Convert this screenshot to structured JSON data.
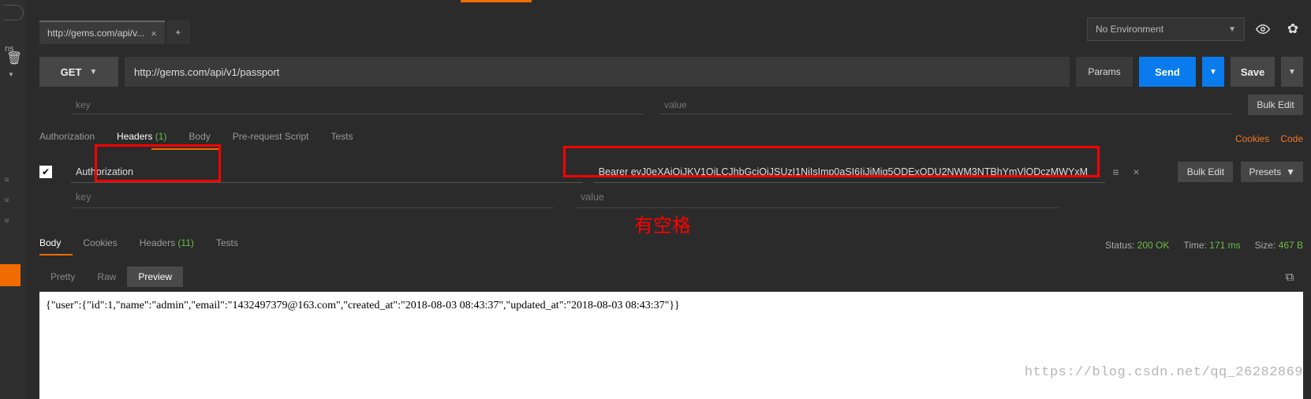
{
  "sidebar": {
    "ns_label": "ns"
  },
  "top": {
    "tab_title": "http://gems.com/api/v...",
    "env_label": "No Environment"
  },
  "request": {
    "method": "GET",
    "url": "http://gems.com/api/v1/passport",
    "params_btn": "Params",
    "send_btn": "Send",
    "save_btn": "Save",
    "key_ph": "key",
    "value_ph": "value",
    "bulk_edit": "Bulk Edit"
  },
  "editor_tabs": {
    "auth": "Authorization",
    "headers_label": "Headers",
    "headers_count": "(1)",
    "body": "Body",
    "prereq": "Pre-request Script",
    "tests": "Tests",
    "cookies": "Cookies",
    "code": "Code"
  },
  "header_row": {
    "key": "Authorization",
    "value": "Bearer eyJ0eXAiOiJKV1QiLCJhbGciOiJSUzI1NiIsImp0aSI6IjJiMjg5ODExODU2NWM3NTBhYmVlODczMWYxM",
    "bulk_edit": "Bulk Edit",
    "presets": "Presets"
  },
  "placeholders": {
    "key": "key",
    "value": "value"
  },
  "annotation": "有空格",
  "resp_tabs": {
    "body": "Body",
    "cookies": "Cookies",
    "headers_label": "Headers",
    "headers_count": "(11)",
    "tests": "Tests",
    "status_label": "Status:",
    "status_val": "200 OK",
    "time_label": "Time:",
    "time_val": "171 ms",
    "size_label": "Size:",
    "size_val": "467 B"
  },
  "view_tabs": {
    "pretty": "Pretty",
    "raw": "Raw",
    "preview": "Preview"
  },
  "response_body": "{\"user\":{\"id\":1,\"name\":\"admin\",\"email\":\"1432497379@163.com\",\"created_at\":\"2018-08-03 08:43:37\",\"updated_at\":\"2018-08-03 08:43:37\"}}",
  "watermark": "https://blog.csdn.net/qq_26282869"
}
